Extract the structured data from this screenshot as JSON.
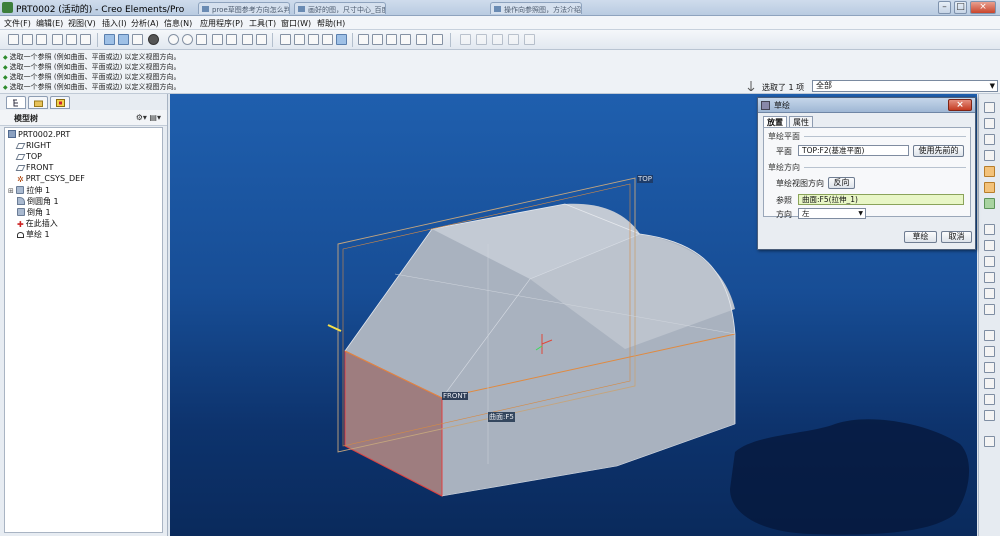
{
  "window": {
    "title": "PRT0002 (活动的) - Creo Elements/Pro",
    "tabs": [
      "proe草图参考方向怎么判断_百度",
      "画好的图，尺寸中心_百度经验",
      "操作向参照图，方法介绍"
    ],
    "controls": [
      "–",
      "□",
      "×"
    ]
  },
  "menu": [
    "文件(F)",
    "编辑(E)",
    "视图(V)",
    "插入(I)",
    "分析(A)",
    "信息(N)",
    "应用程序(P)",
    "工具(T)",
    "窗口(W)",
    "帮助(H)"
  ],
  "messages": [
    "选取一个参照 (例如曲面、平面或边) 以定义视图方向。",
    "选取一个参照 (例如曲面、平面或边) 以定义视图方向。",
    "选取一个参照 (例如曲面、平面或边) 以定义视图方向。",
    "选取一个参照 (例如曲面、平面或边) 以定义视图方向。"
  ],
  "selection": {
    "status": "选取了 1 项",
    "filter": "全部"
  },
  "model_tree": {
    "title": "模型树",
    "items": [
      {
        "label": "PRT0002.PRT",
        "icon": "part-icon"
      },
      {
        "label": "RIGHT",
        "icon": "datum-plane-icon"
      },
      {
        "label": "TOP",
        "icon": "datum-plane-icon"
      },
      {
        "label": "FRONT",
        "icon": "datum-plane-icon"
      },
      {
        "label": "PRT_CSYS_DEF",
        "icon": "csys-icon"
      },
      {
        "label": "拉伸 1",
        "icon": "extrude-icon"
      },
      {
        "label": "倒圆角 1",
        "icon": "round-icon"
      },
      {
        "label": "倒角 1",
        "icon": "chamfer-icon"
      },
      {
        "label": "在此插入",
        "icon": "insert-here-icon"
      },
      {
        "label": "草绘 1",
        "icon": "sketch-icon"
      }
    ]
  },
  "viewport": {
    "labels": {
      "top": "TOP",
      "front": "FRONT",
      "bottom": "曲面:F5"
    }
  },
  "dialog": {
    "title": "草绘",
    "close": "×",
    "tabs": [
      "放置",
      "属性"
    ],
    "plane_section": "草绘平面",
    "plane_label": "平面",
    "plane_value": "TOP:F2(基准平面)",
    "use_previous": "使用先前的",
    "orientation_section": "草绘方向",
    "view_direction_label": "草绘视图方向",
    "flip_button": "反向",
    "reference_label": "参照",
    "reference_value": "曲面:F5(拉伸_1)",
    "direction_label": "方向",
    "direction_value": "左",
    "ok_button": "草绘",
    "cancel_button": "取消"
  }
}
